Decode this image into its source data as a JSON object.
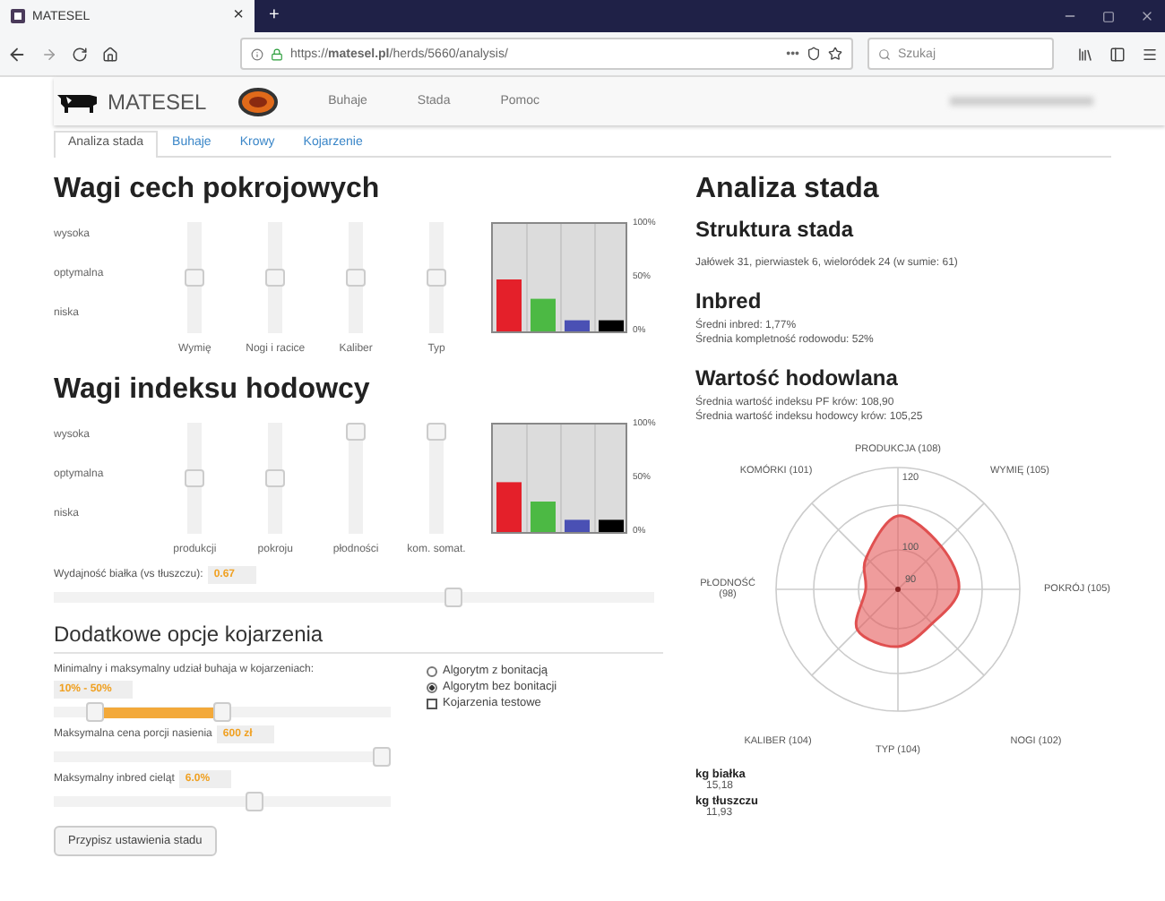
{
  "browser": {
    "tab_title": "MATESEL",
    "tab_close": "×",
    "new_tab": "+",
    "url": "https://**matesel.pl**/herds/5660/analysis/",
    "url_more": "•••",
    "search_placeholder": "Szukaj"
  },
  "site_nav": {
    "brand": "MATESEL",
    "items": [
      "Buhaje",
      "Stada",
      "Pomoc"
    ]
  },
  "subtabs": [
    {
      "label": "Analiza stada",
      "selected": true
    },
    {
      "label": "Buhaje",
      "selected": false
    },
    {
      "label": "Krowy",
      "selected": false
    },
    {
      "label": "Kojarzenie",
      "selected": false
    }
  ],
  "weights_conformation": {
    "title": "Wagi cech pokrojowych",
    "scale": [
      "wysoka",
      "optymalna",
      "niska"
    ],
    "sliders": [
      {
        "label": "Wymię",
        "level": 0.5
      },
      {
        "label": "Nogi i racice",
        "level": 0.5
      },
      {
        "label": "Kaliber",
        "level": 0.5
      },
      {
        "label": "Typ",
        "level": 0.5
      }
    ],
    "chart_data": {
      "type": "bar",
      "ylim": [
        0,
        100
      ],
      "yticks": [
        {
          "value": 0,
          "label": "0%"
        },
        {
          "value": 50,
          "label": "50%"
        },
        {
          "value": 100,
          "label": "100%"
        }
      ],
      "series": [
        {
          "color": "#e4202a",
          "values": [
            50
          ]
        },
        {
          "color": "#4cb944",
          "values": [
            32
          ]
        },
        {
          "color": "#4a50b4",
          "values": [
            12
          ]
        },
        {
          "color": "#000000",
          "values": [
            12
          ]
        }
      ]
    }
  },
  "weights_index": {
    "title": "Wagi indeksu hodowcy",
    "scale": [
      "wysoka",
      "optymalna",
      "niska"
    ],
    "sliders": [
      {
        "label": "produkcji",
        "level": 0.5
      },
      {
        "label": "pokroju",
        "level": 0.5
      },
      {
        "label": "płodności",
        "level": 1
      },
      {
        "label": "kom. somat.",
        "level": 1
      }
    ],
    "chart_data": {
      "type": "bar",
      "ylim": [
        0,
        100
      ],
      "yticks": [
        {
          "value": 0,
          "label": "0%"
        },
        {
          "value": 50,
          "label": "50%"
        },
        {
          "value": 100,
          "label": "100%"
        }
      ],
      "series": [
        {
          "color": "#e4202a",
          "values": [
            48
          ]
        },
        {
          "color": "#4cb944",
          "values": [
            30
          ]
        },
        {
          "color": "#4a50b4",
          "values": [
            13
          ]
        },
        {
          "color": "#000000",
          "values": [
            13
          ]
        }
      ]
    }
  },
  "protein_ratio": {
    "label": "Wydajność białka (vs tłuszczu):",
    "value": "0.67",
    "level": 0.67
  },
  "extra_options": {
    "title": "Dodatkowe opcje kojarzenia",
    "bull_share": {
      "label": "Minimalny i maksymalny udział buhaja w kojarzeniach:",
      "value": "10% - 50%",
      "thumbs": [
        {
          "level": 0.1
        },
        {
          "level": 0.5
        }
      ]
    },
    "max_price": {
      "label": "Maksymalna cena porcji nasienia",
      "value": "600 zł",
      "level": 1
    },
    "max_inbreed": {
      "label": "Maksymalny inbred cieląt",
      "value": "6.0%",
      "level": 0.6
    },
    "options": [
      {
        "kind": "radio",
        "label": "Algorytm z bonitacją",
        "selected": false
      },
      {
        "kind": "radio",
        "label": "Algorytm bez bonitacji",
        "selected": true
      },
      {
        "kind": "checkbox",
        "label": "Kojarzenia testowe",
        "checked": false
      }
    ],
    "button": "Przypisz ustawienia stadu"
  },
  "analysis": {
    "title": "Analiza stada",
    "sections": [
      {
        "title": "Struktura stada",
        "lines": [
          "Jałówek 31, pierwiastek 6, wieloródek 24 (w sumie: 61)"
        ]
      },
      {
        "title": "Inbred",
        "lines": [
          "Średni inbred: 1,77%",
          "Średnia kompletność rodowodu: 52%"
        ]
      },
      {
        "title": "Wartość hodowlana",
        "lines": [
          "Średnia wartość indeksu PF krów: 108,90",
          "Średnia wartość indeksu hodowcy krów: 105,25"
        ]
      }
    ],
    "radar": {
      "axes": [
        "PRODUKCJA (108)",
        "WYMIĘ (105)",
        "POKRÓJ (105)",
        "NOGI (102)",
        "TYP (104)",
        "KALIBER (104)",
        "PŁODNOŚĆ (98)",
        "KOMÓRKI (101)"
      ],
      "ring_labels": [
        "120",
        "100",
        "90"
      ]
    },
    "stats": [
      {
        "label": "kg białka",
        "value": "15,18"
      },
      {
        "label": "kg tłuszczu",
        "value": "11,93"
      }
    ]
  }
}
